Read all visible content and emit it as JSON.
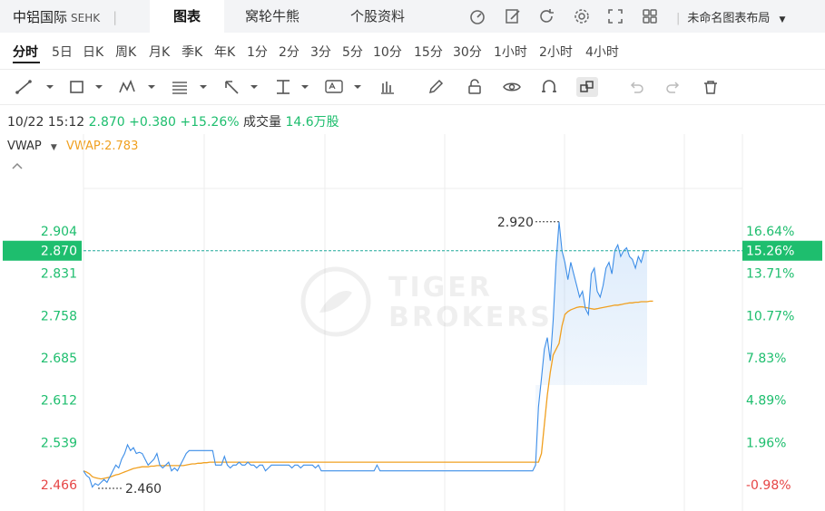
{
  "header": {
    "symbol": "中铝国际",
    "exchange": "SEHK",
    "tabs": [
      {
        "label": "图表",
        "active": true
      },
      {
        "label": "窝轮牛熊",
        "active": false
      },
      {
        "label": "个股资料",
        "active": false
      }
    ],
    "layout_label": "未命名图表布局"
  },
  "periods": [
    "分时",
    "5日",
    "日K",
    "周K",
    "月K",
    "季K",
    "年K",
    "1分",
    "2分",
    "3分",
    "5分",
    "10分",
    "15分",
    "30分",
    "1小时",
    "2小时",
    "4小时"
  ],
  "active_period": "分时",
  "toolbar_icons": [
    "line-tool-icon",
    "rectangle-tool-icon",
    "wave-tool-icon",
    "fibonacci-tool-icon",
    "arrow-tool-icon",
    "measure-tool-icon",
    "text-tool-icon",
    "indicator-icon",
    "pencil-icon",
    "lock-icon",
    "eye-icon",
    "magnet-icon",
    "link-icon",
    "undo-icon",
    "redo-icon",
    "trash-icon"
  ],
  "info": {
    "datetime": "10/22 15:12",
    "price": "2.870",
    "change": "+0.380",
    "change_pct": "+15.26%",
    "volume_label": "成交量",
    "volume": "14.6万股"
  },
  "vwap": {
    "label": "VWAP",
    "value_text": "VWAP:2.783"
  },
  "colors": {
    "up": "#1ebe6e",
    "down": "#e64545",
    "price_line": "#3d8ee8",
    "vwap_line": "#f0a020",
    "current_price_bg": "#1ebe6e",
    "current_price_line": "#1fa89a"
  },
  "chart_data": {
    "type": "line",
    "y_ticks_left": [
      "2.904",
      "2.831",
      "2.758",
      "2.685",
      "2.612",
      "2.539",
      "2.466"
    ],
    "y_tick_values": [
      2.904,
      2.831,
      2.758,
      2.685,
      2.612,
      2.539,
      2.466
    ],
    "y_ticks_right": [
      "16.64%",
      "13.71%",
      "10.77%",
      "7.83%",
      "4.89%",
      "1.96%",
      "-0.98%"
    ],
    "ylim": [
      2.466,
      2.904
    ],
    "current_price": 2.87,
    "current_price_text": "2.870",
    "current_pct_text": "15.26%",
    "prev_close": 2.49,
    "high_label": "2.920",
    "high": 2.92,
    "low_label": "2.460",
    "low": 2.46,
    "series": [
      {
        "name": "price",
        "values": [
          2.49,
          2.482,
          2.478,
          2.462,
          2.468,
          2.465,
          2.47,
          2.475,
          2.47,
          2.48,
          2.49,
          2.5,
          2.495,
          2.51,
          2.52,
          2.535,
          2.525,
          2.53,
          2.52,
          2.522,
          2.52,
          2.51,
          2.5,
          2.505,
          2.51,
          2.52,
          2.5,
          2.495,
          2.5,
          2.505,
          2.49,
          2.495,
          2.49,
          2.5,
          2.51,
          2.52,
          2.525,
          2.525,
          2.525,
          2.525,
          2.525,
          2.525,
          2.525,
          2.525,
          2.525,
          2.5,
          2.5,
          2.5,
          2.515,
          2.5,
          2.495,
          2.5,
          2.5,
          2.505,
          2.5,
          2.5,
          2.505,
          2.5,
          2.5,
          2.495,
          2.5,
          2.5,
          2.49,
          2.495,
          2.5,
          2.5,
          2.5,
          2.5,
          2.5,
          2.5,
          2.5,
          2.495,
          2.5,
          2.5,
          2.495,
          2.5,
          2.5,
          2.5,
          2.5,
          2.495,
          2.5,
          2.49,
          2.49,
          2.49,
          2.49,
          2.49,
          2.49,
          2.49,
          2.49,
          2.49,
          2.49,
          2.49,
          2.49,
          2.49,
          2.49,
          2.49,
          2.49,
          2.49,
          2.49,
          2.49,
          2.5,
          2.49,
          2.49,
          2.49,
          2.49,
          2.49,
          2.49,
          2.49,
          2.49,
          2.49,
          2.49,
          2.49,
          2.49,
          2.49,
          2.49,
          2.49,
          2.49,
          2.49,
          2.49,
          2.49,
          2.49,
          2.49,
          2.49,
          2.49,
          2.49,
          2.49,
          2.49,
          2.49,
          2.49,
          2.49,
          2.49,
          2.49,
          2.49,
          2.49,
          2.49,
          2.49,
          2.49,
          2.49,
          2.49,
          2.49,
          2.49,
          2.49,
          2.49,
          2.49,
          2.49,
          2.49,
          2.49,
          2.49,
          2.49,
          2.49,
          2.49,
          2.49,
          2.49,
          2.49,
          2.5,
          2.6,
          2.65,
          2.7,
          2.72,
          2.68,
          2.75,
          2.85,
          2.92,
          2.87,
          2.85,
          2.82,
          2.85,
          2.83,
          2.81,
          2.79,
          2.8,
          2.77,
          2.76,
          2.83,
          2.84,
          2.8,
          2.79,
          2.81,
          2.84,
          2.85,
          2.83,
          2.87,
          2.88,
          2.86,
          2.87,
          2.875,
          2.86,
          2.855,
          2.84,
          2.86,
          2.85,
          2.87,
          2.87
        ]
      },
      {
        "name": "VWAP",
        "values": [
          2.49,
          2.488,
          2.485,
          2.48,
          2.478,
          2.477,
          2.476,
          2.477,
          2.478,
          2.479,
          2.481,
          2.483,
          2.484,
          2.486,
          2.488,
          2.49,
          2.492,
          2.494,
          2.495,
          2.496,
          2.497,
          2.497,
          2.497,
          2.498,
          2.498,
          2.499,
          2.499,
          2.499,
          2.499,
          2.499,
          2.499,
          2.499,
          2.499,
          2.499,
          2.499,
          2.5,
          2.501,
          2.502,
          2.502,
          2.503,
          2.503,
          2.504,
          2.504,
          2.505,
          2.505,
          2.505,
          2.505,
          2.505,
          2.505,
          2.505,
          2.505,
          2.505,
          2.505,
          2.505,
          2.505,
          2.505,
          2.505,
          2.505,
          2.505,
          2.505,
          2.505,
          2.505,
          2.505,
          2.505,
          2.505,
          2.505,
          2.505,
          2.505,
          2.505,
          2.505,
          2.505,
          2.505,
          2.505,
          2.505,
          2.505,
          2.505,
          2.505,
          2.505,
          2.505,
          2.505,
          2.505,
          2.505,
          2.505,
          2.505,
          2.505,
          2.505,
          2.505,
          2.505,
          2.505,
          2.505,
          2.505,
          2.505,
          2.505,
          2.505,
          2.505,
          2.505,
          2.505,
          2.505,
          2.505,
          2.505,
          2.505,
          2.505,
          2.505,
          2.505,
          2.505,
          2.505,
          2.505,
          2.505,
          2.505,
          2.505,
          2.505,
          2.505,
          2.505,
          2.505,
          2.505,
          2.505,
          2.505,
          2.505,
          2.505,
          2.505,
          2.505,
          2.505,
          2.505,
          2.505,
          2.505,
          2.505,
          2.505,
          2.505,
          2.505,
          2.505,
          2.505,
          2.505,
          2.505,
          2.505,
          2.505,
          2.505,
          2.505,
          2.505,
          2.505,
          2.505,
          2.505,
          2.505,
          2.505,
          2.505,
          2.505,
          2.505,
          2.505,
          2.505,
          2.505,
          2.505,
          2.505,
          2.505,
          2.505,
          2.505,
          2.505,
          2.505,
          2.52,
          2.57,
          2.62,
          2.66,
          2.69,
          2.7,
          2.71,
          2.74,
          2.76,
          2.765,
          2.768,
          2.77,
          2.772,
          2.773,
          2.773,
          2.772,
          2.771,
          2.77,
          2.769,
          2.77,
          2.771,
          2.772,
          2.773,
          2.774,
          2.775,
          2.776,
          2.776,
          2.777,
          2.778,
          2.779,
          2.78,
          2.78,
          2.781,
          2.781,
          2.782,
          2.782,
          2.782,
          2.783,
          2.783
        ]
      }
    ]
  }
}
